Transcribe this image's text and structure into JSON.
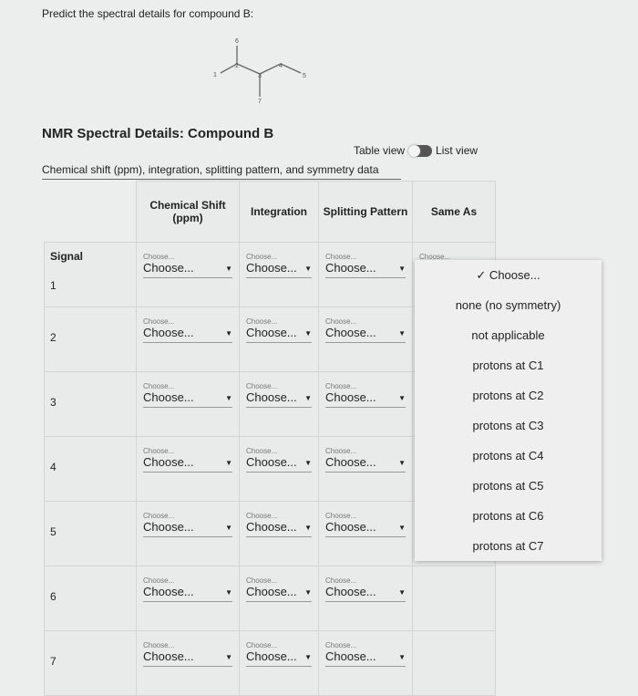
{
  "prompt": "Predict the spectral details for compound B:",
  "molecule": {
    "atoms": [
      "1",
      "2",
      "3",
      "4",
      "5",
      "6",
      "7"
    ]
  },
  "title": "NMR Spectral Details: Compound B",
  "toggle": {
    "left": "Table view",
    "right": "List view",
    "state": "list"
  },
  "caption": "Chemical shift (ppm), integration, splitting pattern, and symmetry data",
  "headers": [
    "Signal",
    "Chemical Shift (ppm)",
    "Integration",
    "Splitting Pattern",
    "Same As"
  ],
  "select": {
    "label": "Choose...",
    "value": "Choose...",
    "arrow": "▼"
  },
  "signals": [
    "1",
    "2",
    "3",
    "4",
    "5",
    "6",
    "7"
  ],
  "menu": [
    "✓ Choose...",
    "none (no symmetry)",
    "not applicable",
    "protons at C1",
    "protons at C2",
    "protons at C3",
    "protons at C4",
    "protons at C5",
    "protons at C6",
    "protons at C7"
  ]
}
